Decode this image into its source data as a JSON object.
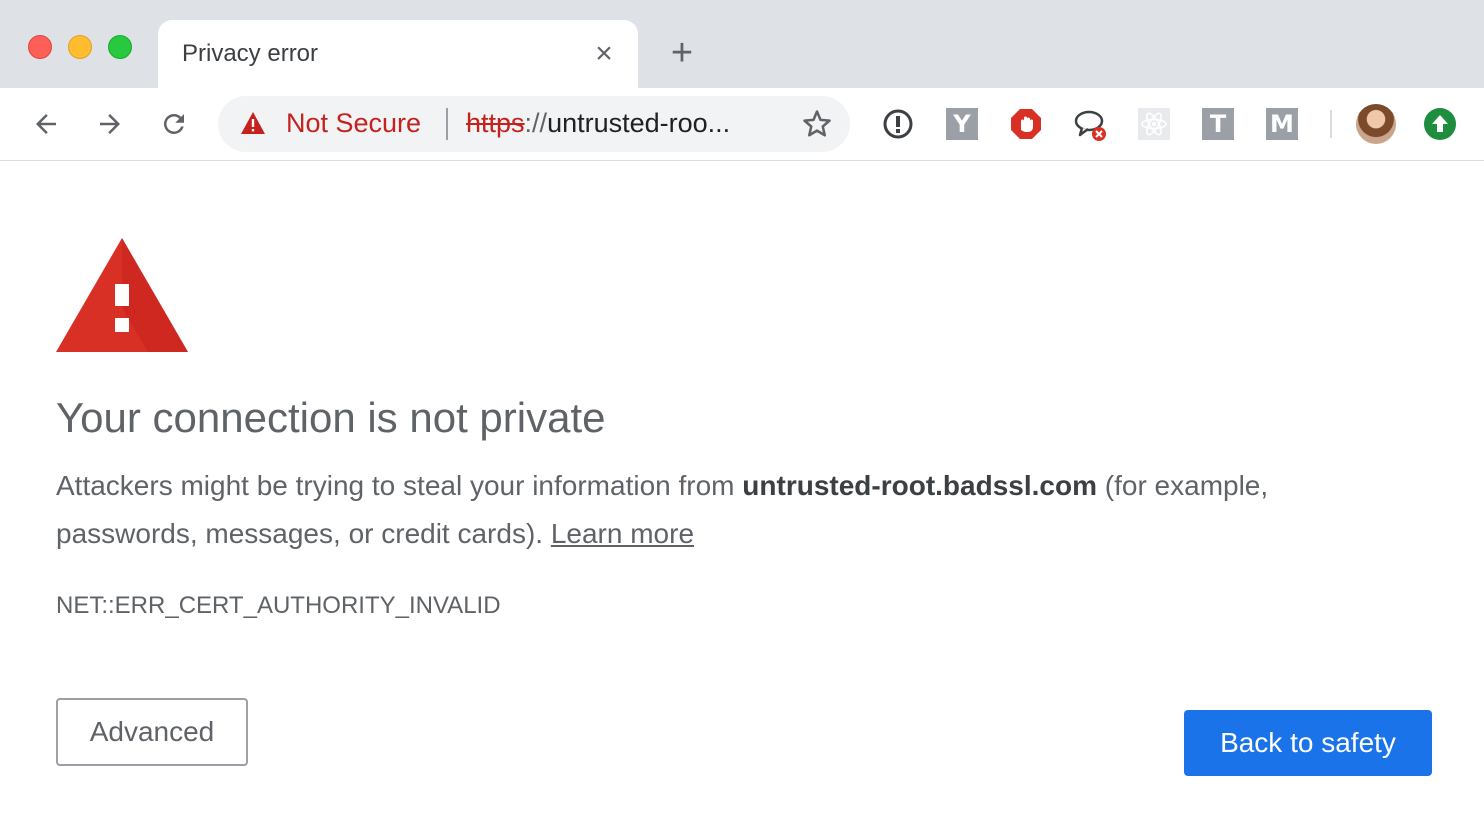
{
  "tab": {
    "title": "Privacy error"
  },
  "omnibox": {
    "security_label": "Not Secure",
    "url_scheme": "https",
    "url_separator": "://",
    "url_rest": "untrusted-roo..."
  },
  "extensions": {
    "y_label": "Y",
    "t_label": "T",
    "m_label": "M"
  },
  "page": {
    "heading": "Your connection is not private",
    "para_prefix": "Attackers might be trying to steal your information from ",
    "domain": "untrusted-root.badssl.com",
    "para_suffix": " (for example, passwords, messages, or credit cards). ",
    "learn_more": "Learn more",
    "error_code": "NET::ERR_CERT_AUTHORITY_INVALID",
    "advanced_label": "Advanced",
    "back_label": "Back to safety"
  },
  "colors": {
    "warning_red": "#d93025",
    "primary_blue": "#1a73e8",
    "not_secure_red": "#c5221f"
  }
}
